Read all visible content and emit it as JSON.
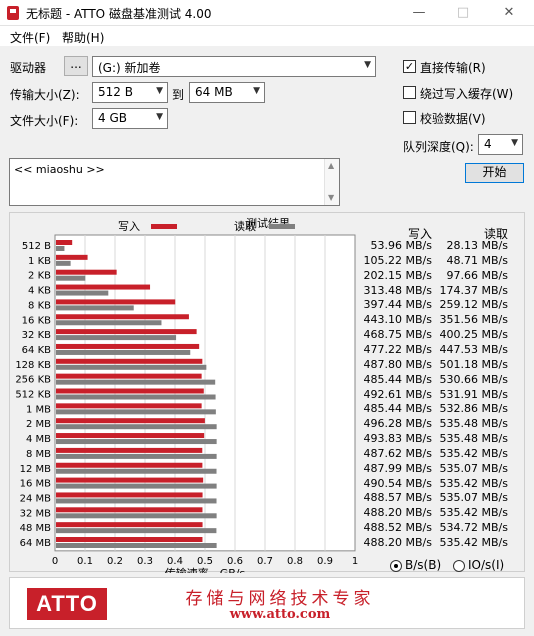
{
  "window": {
    "title": "无标题 - ATTO 磁盘基准测试 4.00"
  },
  "menu": [
    {
      "label": "文件(F)"
    },
    {
      "label": "帮助(H)"
    }
  ],
  "controls": {
    "drive_label": "驱动器",
    "browse_label": "...",
    "drive_value": "(G:) 新加卷",
    "transfer_label": "传输大小(Z):",
    "transfer_from": "512 B",
    "to_label": "到",
    "transfer_to": "64 MB",
    "file_size_label": "文件大小(F):",
    "file_size": "4 GB",
    "direct_io": {
      "label": "直接传输(R)",
      "checked": true
    },
    "bypass_cache": {
      "label": "绕过写入缓存(W)",
      "checked": false
    },
    "verify": {
      "label": "校验数据(V)",
      "checked": false
    },
    "queue_label": "队列深度(Q):",
    "queue_value": "4",
    "start_label": "开始",
    "description": "<< miaoshu >>"
  },
  "results": {
    "title": "测试结果",
    "legend_write": "写入",
    "legend_read": "读取",
    "col_write": "写入",
    "col_read": "读取",
    "write_values": [
      "53.96 MB/s",
      "105.22 MB/s",
      "202.15 MB/s",
      "313.48 MB/s",
      "397.44 MB/s",
      "443.10 MB/s",
      "468.75 MB/s",
      "477.22 MB/s",
      "487.80 MB/s",
      "485.44 MB/s",
      "492.61 MB/s",
      "485.44 MB/s",
      "496.28 MB/s",
      "493.83 MB/s",
      "487.62 MB/s",
      "487.99 MB/s",
      "490.54 MB/s",
      "488.57 MB/s",
      "488.20 MB/s",
      "488.52 MB/s",
      "488.20 MB/s"
    ],
    "read_values": [
      "28.13 MB/s",
      "48.71 MB/s",
      "97.66 MB/s",
      "174.37 MB/s",
      "259.12 MB/s",
      "351.56 MB/s",
      "400.25 MB/s",
      "447.53 MB/s",
      "501.18 MB/s",
      "530.66 MB/s",
      "531.91 MB/s",
      "532.86 MB/s",
      "535.48 MB/s",
      "535.48 MB/s",
      "535.42 MB/s",
      "535.07 MB/s",
      "535.42 MB/s",
      "535.07 MB/s",
      "535.42 MB/s",
      "534.72 MB/s",
      "535.42 MB/s"
    ],
    "unit_bytes": {
      "label": "B/s(B)",
      "selected": true
    },
    "unit_io": {
      "label": "IO/s(I)",
      "selected": false
    }
  },
  "chart_data": {
    "type": "bar",
    "orientation": "horizontal",
    "title": "测试结果",
    "xlabel": "传输速率 - GB/s",
    "ylabel": "",
    "xlim": [
      0,
      1
    ],
    "xticks": [
      "0",
      "0.1",
      "0.2",
      "0.3",
      "0.4",
      "0.5",
      "0.6",
      "0.7",
      "0.8",
      "0.9",
      "1"
    ],
    "categories": [
      "512 B",
      "1 KB",
      "2 KB",
      "4 KB",
      "8 KB",
      "16 KB",
      "32 KB",
      "64 KB",
      "128 KB",
      "256 KB",
      "512 KB",
      "1 MB",
      "2 MB",
      "4 MB",
      "8 MB",
      "12 MB",
      "16 MB",
      "24 MB",
      "32 MB",
      "48 MB",
      "64 MB"
    ],
    "series": [
      {
        "name": "写入",
        "color": "#c8202a",
        "values": [
          0.05396,
          0.10522,
          0.20215,
          0.31348,
          0.39744,
          0.4431,
          0.46875,
          0.47722,
          0.4878,
          0.48544,
          0.49261,
          0.48544,
          0.49628,
          0.49383,
          0.48762,
          0.48799,
          0.49054,
          0.48857,
          0.4882,
          0.48852,
          0.4882
        ]
      },
      {
        "name": "读取",
        "color": "#808080",
        "values": [
          0.02813,
          0.04871,
          0.09766,
          0.17437,
          0.25912,
          0.35156,
          0.40025,
          0.44753,
          0.50118,
          0.53066,
          0.53191,
          0.53286,
          0.53548,
          0.53548,
          0.53542,
          0.53507,
          0.53542,
          0.53507,
          0.53542,
          0.53472,
          0.53542
        ]
      }
    ],
    "grid": true,
    "legend_position": "top"
  },
  "footer": {
    "logo_text": "ATTO",
    "slogan": "存储与网络技术专家",
    "website": "www.atto.com"
  }
}
